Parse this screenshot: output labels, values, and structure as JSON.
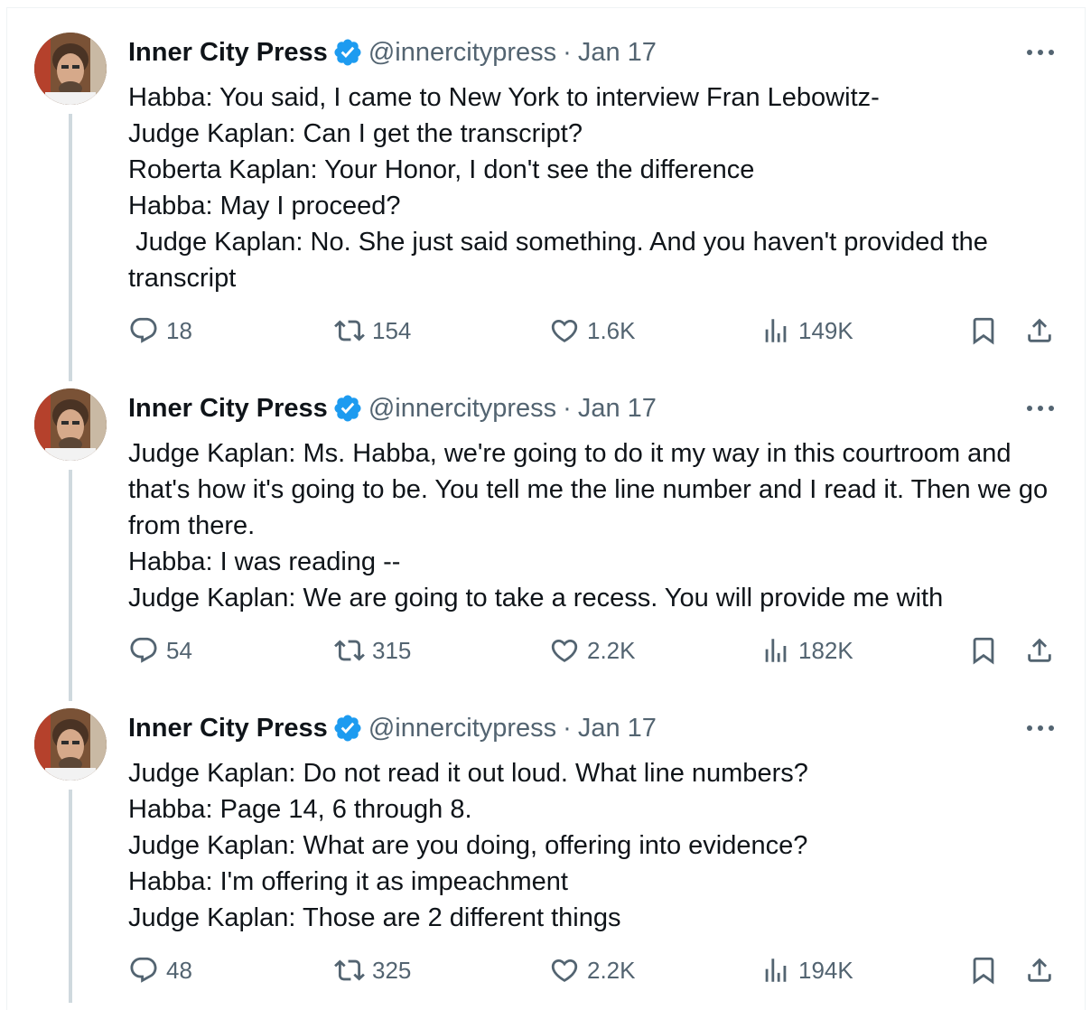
{
  "tweets": [
    {
      "author": "Inner City Press",
      "handle": "@innercitypress",
      "separator": "·",
      "date": "Jan 17",
      "text": "Habba: You said, I came to New York to interview Fran Lebowitz-\nJudge Kaplan: Can I get the transcript?\nRoberta Kaplan: Your Honor, I don't see the difference\nHabba: May I proceed?\n Judge Kaplan: No. She just said something. And you haven't provided the transcript",
      "replies": "18",
      "reposts": "154",
      "likes": "1.6K",
      "views": "149K"
    },
    {
      "author": "Inner City Press",
      "handle": "@innercitypress",
      "separator": "·",
      "date": "Jan 17",
      "text": "Judge Kaplan: Ms. Habba, we're going to do it my way in this courtroom and that's how it's going to be. You tell me the line number and I read it. Then we go from there.\nHabba: I was reading --\nJudge Kaplan: We are going to take a recess. You will provide me with",
      "replies": "54",
      "reposts": "315",
      "likes": "2.2K",
      "views": "182K"
    },
    {
      "author": "Inner City Press",
      "handle": "@innercitypress",
      "separator": "·",
      "date": "Jan 17",
      "text": "Judge Kaplan: Do not read it out loud. What line numbers?\nHabba: Page 14, 6 through 8.\nJudge Kaplan: What are you doing, offering into evidence?\nHabba: I'm offering it as impeachment\nJudge Kaplan: Those are 2 different things",
      "replies": "48",
      "reposts": "325",
      "likes": "2.2K",
      "views": "194K"
    }
  ],
  "colors": {
    "text": "#0f1419",
    "muted": "#536471",
    "verified": "#1d9bf0",
    "thread_line": "#cfd9de"
  },
  "icons": {
    "verified": "verified-badge-icon",
    "more": "more-dots-icon",
    "reply": "reply-icon",
    "repost": "repost-icon",
    "like": "like-icon",
    "views": "views-icon",
    "bookmark": "bookmark-icon",
    "share": "share-icon"
  }
}
